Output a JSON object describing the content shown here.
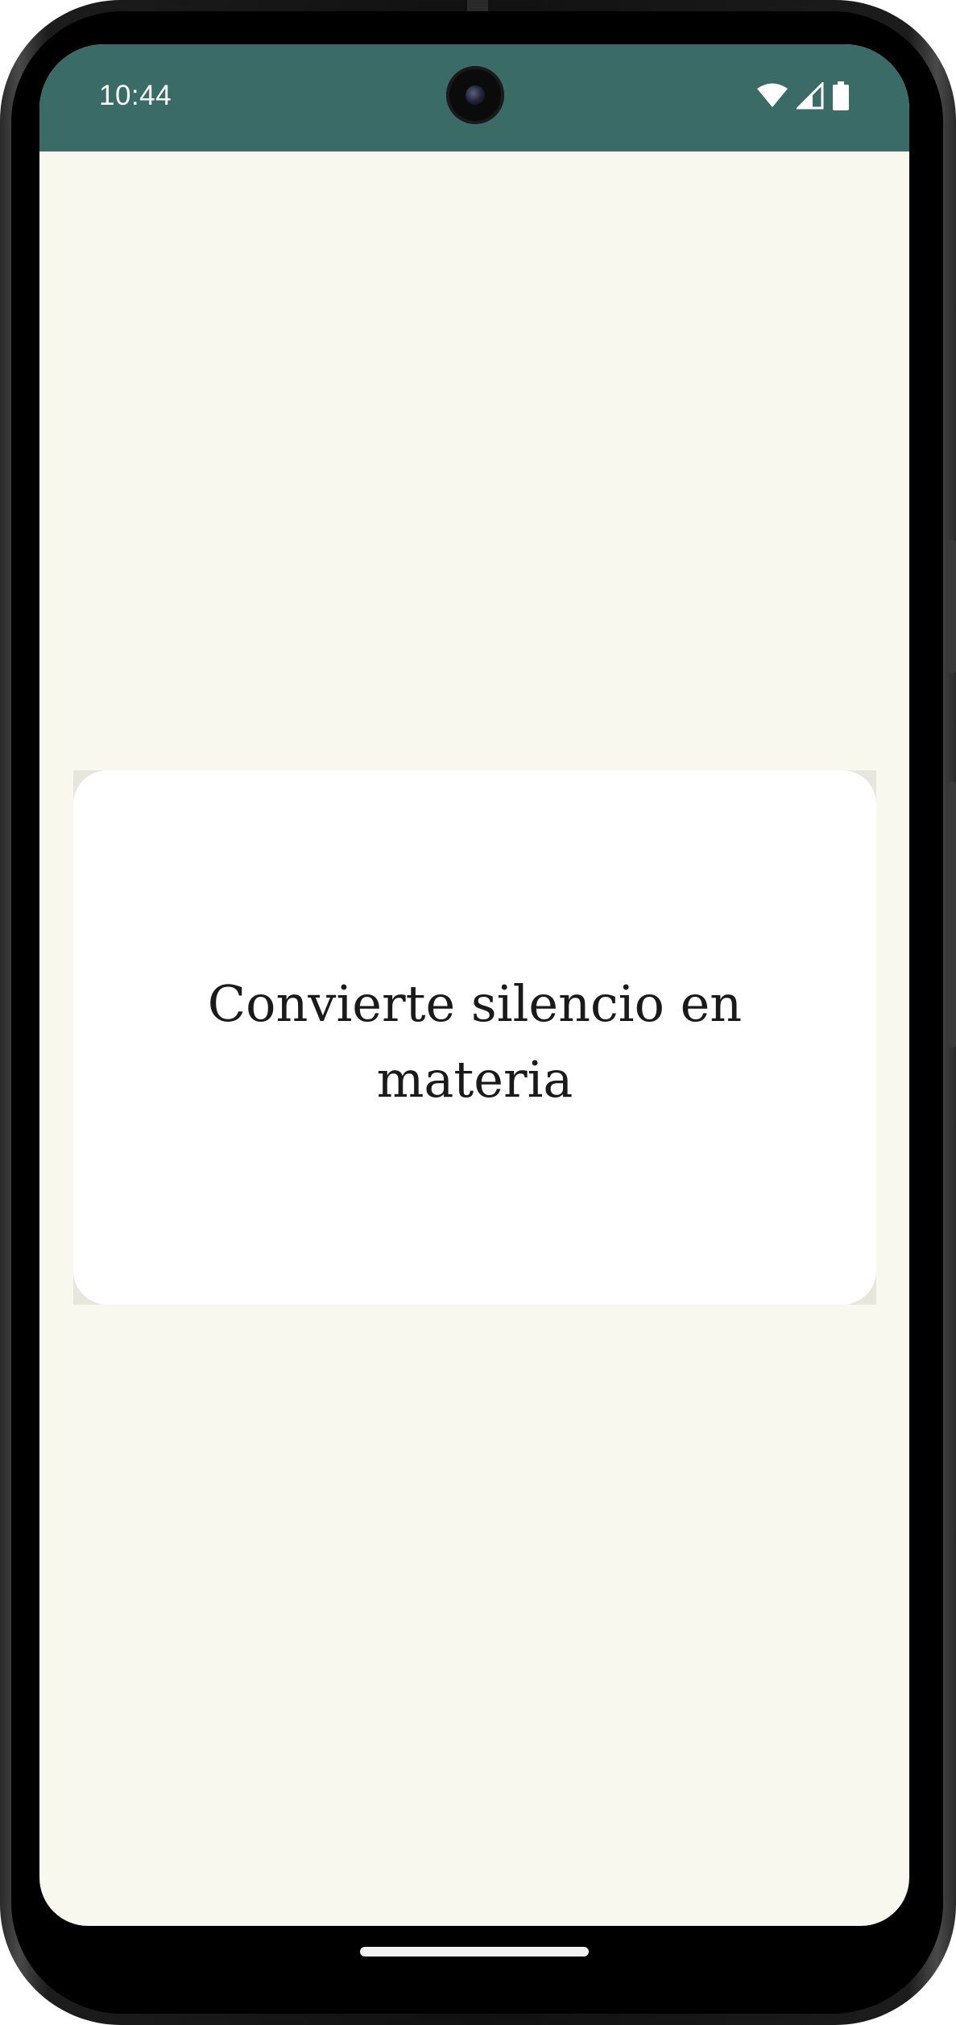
{
  "status_bar": {
    "time": "10:44",
    "icons": [
      "wifi-icon",
      "cellular-signal-icon",
      "battery-icon"
    ]
  },
  "card": {
    "text": "Convierte silencio en materia"
  },
  "colors": {
    "status_bar": "#3b6b66",
    "background": "#f8f8ee",
    "card": "#ffffff",
    "text": "#1a1a1a"
  }
}
